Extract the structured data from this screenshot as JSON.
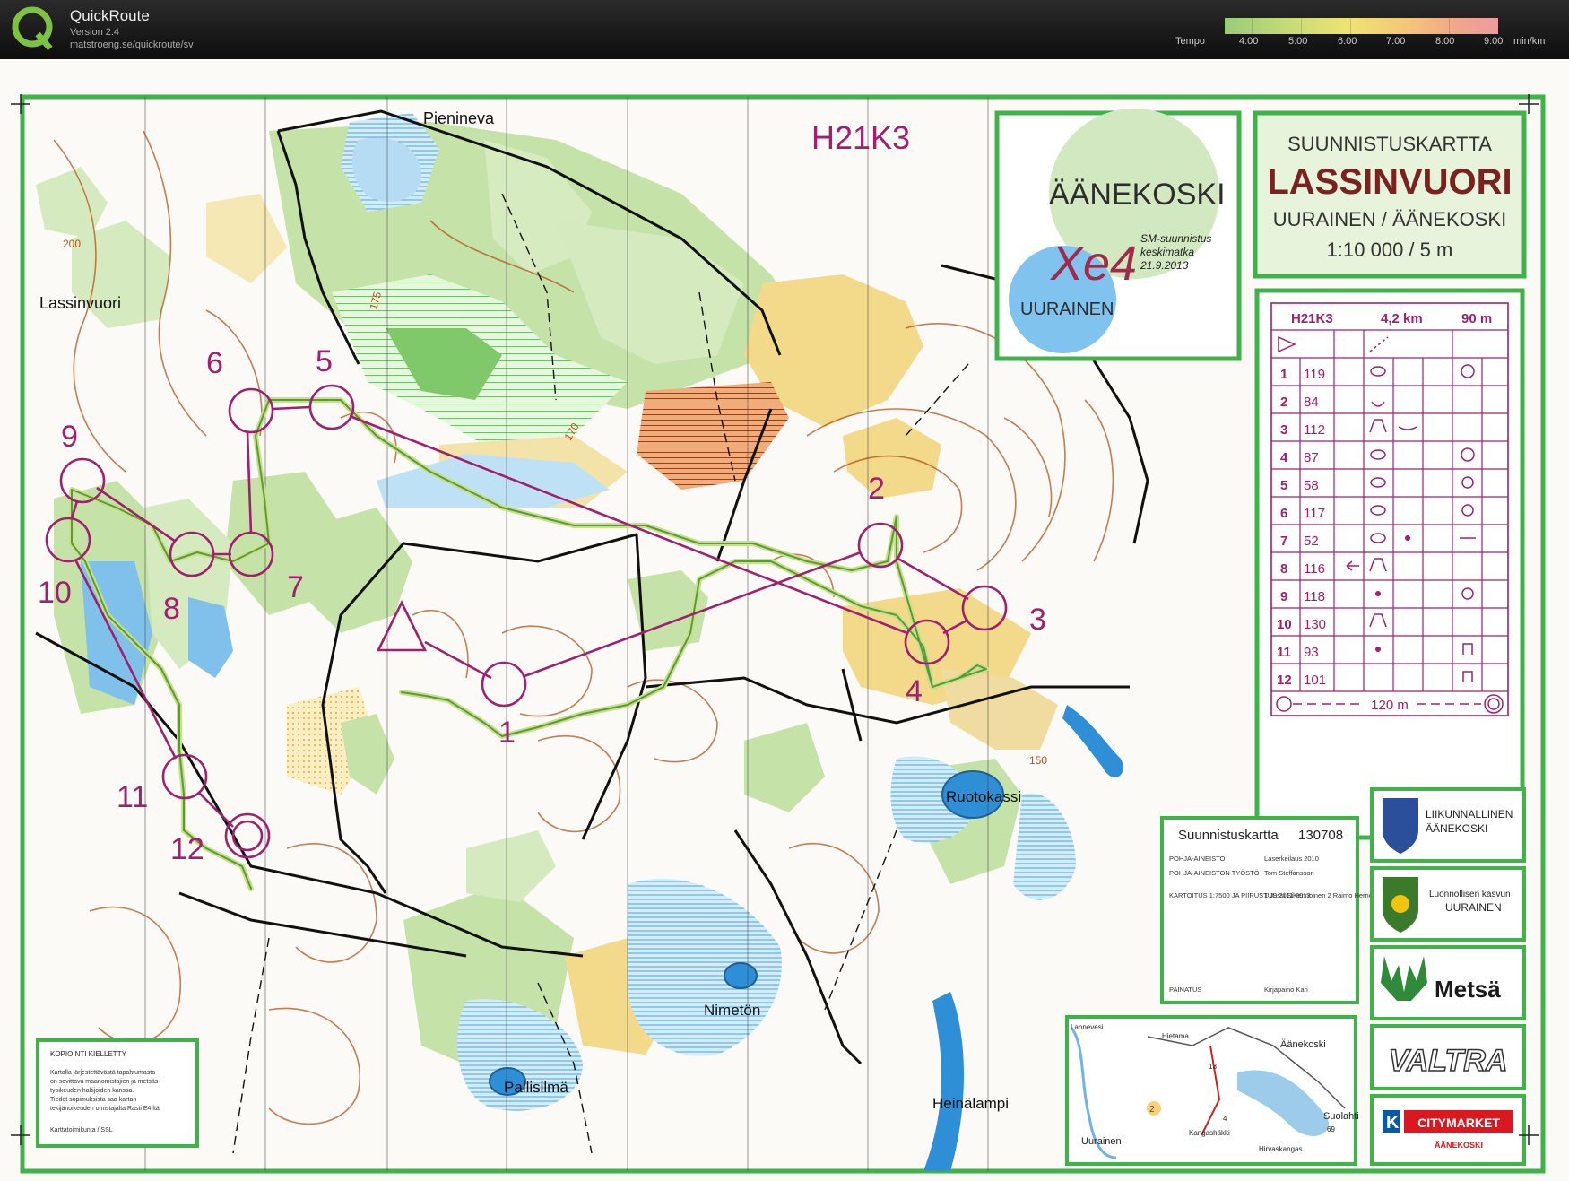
{
  "app": {
    "name": "QuickRoute",
    "version": "Version 2.4",
    "url": "matstroeng.se/quickroute/sv"
  },
  "tempo": {
    "label": "Tempo",
    "ticks": [
      "4:00",
      "5:00",
      "6:00",
      "7:00",
      "8:00",
      "9:00"
    ],
    "unit": "min/km"
  },
  "map": {
    "course_title": "H21K3",
    "header_line1": "SUUNNISTUSKARTTA",
    "header_name": "LASSINVUORI",
    "header_area": "UURAINEN / ÄÄNEKOSKI",
    "header_scale": "1:10 000 / 5 m",
    "event": {
      "town": "ÄÄNEKOSKI",
      "logo_letters": "Xe4",
      "host": "UURAINEN",
      "line1": "SM-suunnistus",
      "line2": "keskimatka",
      "date": "21.9.2013"
    },
    "place_names": {
      "pienineva": "Pienineva",
      "lassinvuori": "Lassinvuori",
      "ruotokassi": "Ruotokassi",
      "nimeton": "Nimetön",
      "pallisilma": "Pallisilmä",
      "heinalampi": "Heinälampi"
    },
    "contours": {
      "c200": "200",
      "c175": "175",
      "c170": "170",
      "c150": "150"
    },
    "control_numbers": [
      "1",
      "2",
      "3",
      "4",
      "5",
      "6",
      "7",
      "8",
      "9",
      "10",
      "11",
      "12"
    ],
    "info_box": {
      "title": "Suunnistuskartta",
      "number": "130708",
      "rows": [
        {
          "label": "POHJA-AINEISTO",
          "value": "Laserkeilaus 2010"
        },
        {
          "label": "POHJA-AINEISTON TYÖSTÖ",
          "value": "Tom Steffansson"
        },
        {
          "label": "KARTOITUS 1:7500 JA PIIRUSTUS 2011-2013",
          "value": "1 Jussi Silvennoinen 2 Raimo Hernesmaa"
        },
        {
          "label": "PAINATUS",
          "value": "Kirjapaino Kari"
        }
      ]
    },
    "copyright": {
      "title": "KOPIOINTI KIELLETTY",
      "lines": [
        "Kartalla järjestettävästä tapahtumasta",
        "on sovittava maanomistajien ja metsäs-",
        "tyoikeuden haltijoiden kanssa.",
        "Tiedot sopimuksista saa kartan",
        "tekijänoikeuden omistajalta Rasti E4:ltä"
      ],
      "footer": "Karttatoimikunta / SSL"
    },
    "sponsors": {
      "liikunnallinen_1": "LIIKUNNALLINEN",
      "liikunnallinen_2": "ÄÄNEKOSKI",
      "luonnollisen_1": "Luonnollisen kasvun",
      "luonnollisen_2": "UURAINEN",
      "metsa": "Metsä",
      "valtra": "VALTRA",
      "citymarket": "CITYMARKET",
      "citymarket_sub": "ÄÄNEKOSKI",
      "k_letter": "K"
    },
    "inset_map": {
      "labels": [
        "Lannevesi",
        "Hietama",
        "Äänekoski",
        "Suolahti",
        "Uurainen",
        "Kangashäkki",
        "Hirvaskangas"
      ],
      "road_numbers": [
        "13",
        "4",
        "69"
      ],
      "marker": "2"
    }
  },
  "control_card": {
    "course": "H21K3",
    "length": "4,2 km",
    "climb": "90 m",
    "rows": [
      {
        "n": "1",
        "code": "119"
      },
      {
        "n": "2",
        "code": "84"
      },
      {
        "n": "3",
        "code": "112"
      },
      {
        "n": "4",
        "code": "87"
      },
      {
        "n": "5",
        "code": "58"
      },
      {
        "n": "6",
        "code": "117"
      },
      {
        "n": "7",
        "code": "52"
      },
      {
        "n": "8",
        "code": "116"
      },
      {
        "n": "9",
        "code": "118"
      },
      {
        "n": "10",
        "code": "130"
      },
      {
        "n": "11",
        "code": "93"
      },
      {
        "n": "12",
        "code": "101"
      }
    ],
    "finish_distance": "120 m"
  },
  "colors": {
    "course_purple": "#a0206e",
    "frame_green": "#3fb24a",
    "route_green": "#5a9a3a",
    "forest_green": "#bfe0a5",
    "open_yellow": "#f4d77e",
    "water_blue": "#2e8fd6",
    "contour_brown": "#b5521e"
  }
}
